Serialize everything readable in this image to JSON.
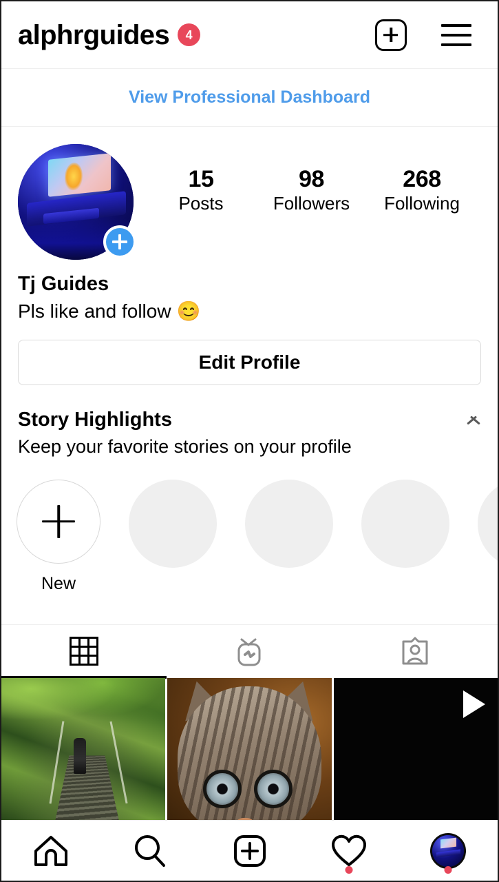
{
  "header": {
    "username": "alphrguides",
    "notification_badge": "4",
    "new_post_icon": "plus-square-icon",
    "menu_icon": "hamburger-menu-icon",
    "badge_color": "#e8475a"
  },
  "pro_dashboard": {
    "label": "View Professional Dashboard",
    "link_color": "#4f9cea"
  },
  "profile": {
    "avatar_alt": "blue-lit gaming desk setup",
    "add_story_icon": "plus-circle-icon",
    "add_story_color": "#3d9bf0",
    "stats": [
      {
        "value": "15",
        "label": "Posts"
      },
      {
        "value": "98",
        "label": "Followers"
      },
      {
        "value": "268",
        "label": "Following"
      }
    ],
    "display_name": "Tj Guides",
    "bio": "Pls like and follow",
    "bio_emoji": "😊",
    "edit_profile_label": "Edit Profile"
  },
  "highlights": {
    "title": "Story Highlights",
    "subtitle": "Keep your favorite stories on your profile",
    "collapse_icon": "chevron-up-icon",
    "new_label": "New",
    "new_icon": "plus-icon",
    "placeholder_count": 4,
    "placeholder_color": "#efefef"
  },
  "tabs": [
    {
      "name": "grid",
      "icon": "grid-icon",
      "active": true
    },
    {
      "name": "igtv",
      "icon": "igtv-icon",
      "active": false
    },
    {
      "name": "tagged",
      "icon": "tagged-person-icon",
      "active": false
    }
  ],
  "posts": [
    {
      "type": "photo",
      "alt": "suspension bridge through green jungle"
    },
    {
      "type": "photo",
      "alt": "close-up of tabby kitten face"
    },
    {
      "type": "video",
      "alt": "dark video thumbnail",
      "overlay_icon": "play-icon"
    }
  ],
  "bottom_nav": [
    {
      "name": "home",
      "icon": "home-icon",
      "dot": false
    },
    {
      "name": "search",
      "icon": "search-icon",
      "dot": false
    },
    {
      "name": "create",
      "icon": "plus-square-icon",
      "dot": false
    },
    {
      "name": "activity",
      "icon": "heart-icon",
      "dot": true
    },
    {
      "name": "profile",
      "icon": "profile-avatar",
      "dot": true
    }
  ]
}
